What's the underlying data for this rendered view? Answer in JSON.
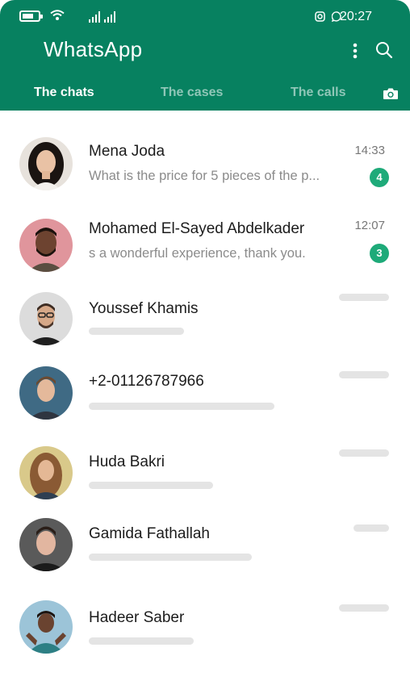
{
  "status_bar": {
    "time": "20:27",
    "battery_level": 0.7,
    "icons": [
      "battery-icon",
      "wifi-icon",
      "signal-icon",
      "signal-icon",
      "instagram-icon",
      "whatsapp-icon"
    ]
  },
  "app": {
    "title": "WhatsApp",
    "accent_color": "#078160",
    "badge_color": "#1eaa79",
    "actions": [
      "more-vert-icon",
      "search-icon"
    ]
  },
  "tabs": [
    {
      "label": "The chats",
      "active": true
    },
    {
      "label": "The cases",
      "active": false
    },
    {
      "label": "The calls",
      "active": false
    }
  ],
  "chats": [
    {
      "name": "Mena Joda",
      "message": "What is the price for 5 pieces of the p...",
      "time": "14:33",
      "unread": "4"
    },
    {
      "name": "Mohamed El-Sayed Abdelkader",
      "message": "s a wonderful experience, thank you.",
      "time": "12:07",
      "unread": "3"
    },
    {
      "name": "Youssef Khamis",
      "message": "",
      "time": "",
      "unread": ""
    },
    {
      "name": "+2-01126787966",
      "message": "",
      "time": "",
      "unread": ""
    },
    {
      "name": "Huda Bakri",
      "message": "",
      "time": "",
      "unread": ""
    },
    {
      "name": "Gamida Fathallah",
      "message": "",
      "time": "",
      "unread": ""
    },
    {
      "name": "Hadeer Saber",
      "message": "",
      "time": "",
      "unread": ""
    }
  ]
}
